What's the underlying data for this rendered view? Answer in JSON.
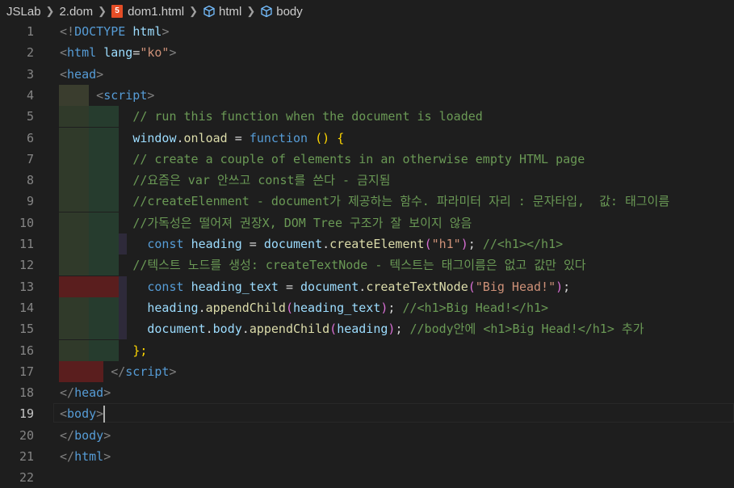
{
  "breadcrumb": {
    "items": [
      "JSLab",
      "2.dom",
      "dom1.html",
      "html",
      "body"
    ],
    "html5_badge": "5"
  },
  "editor": {
    "active_line": 19,
    "line_numbers": [
      "1",
      "2",
      "3",
      "4",
      "5",
      "6",
      "7",
      "8",
      "9",
      "10",
      "11",
      "12",
      "13",
      "14",
      "15",
      "16",
      "17",
      "18",
      "19",
      "20",
      "21",
      "22"
    ],
    "lines": [
      [
        [
          "brk",
          "<!"
        ],
        [
          "tag",
          "DOCTYPE"
        ],
        [
          "txt",
          " "
        ],
        [
          "attr",
          "html"
        ],
        [
          "brk",
          ">"
        ]
      ],
      [
        [
          "brk",
          "<"
        ],
        [
          "tag",
          "html"
        ],
        [
          "txt",
          " "
        ],
        [
          "attr",
          "lang"
        ],
        [
          "txt",
          "="
        ],
        [
          "str",
          "\"ko\""
        ],
        [
          "brk",
          ">"
        ]
      ],
      [
        [
          "brk",
          "<"
        ],
        [
          "tag",
          "head"
        ],
        [
          "brk",
          ">"
        ]
      ],
      [
        [
          "txt",
          "     "
        ],
        [
          "brk",
          "<"
        ],
        [
          "tag",
          "script"
        ],
        [
          "brk",
          ">"
        ]
      ],
      [
        [
          "txt",
          "          "
        ],
        [
          "cmt",
          "// run this function when the document is loaded"
        ]
      ],
      [
        [
          "txt",
          "          "
        ],
        [
          "var",
          "window"
        ],
        [
          "txt",
          "."
        ],
        [
          "fn",
          "onload"
        ],
        [
          "txt",
          " = "
        ],
        [
          "kw",
          "function"
        ],
        [
          "txt",
          " "
        ],
        [
          "paren2",
          "()"
        ],
        [
          "txt",
          " "
        ],
        [
          "paren2",
          "{"
        ]
      ],
      [
        [
          "txt",
          "          "
        ],
        [
          "cmt",
          "// create a couple of elements in an otherwise empty HTML page"
        ]
      ],
      [
        [
          "txt",
          "          "
        ],
        [
          "cmt",
          "//요즘은 var 안쓰고 const를 쓴다 - 금지됨"
        ]
      ],
      [
        [
          "txt",
          "          "
        ],
        [
          "cmt",
          "//createElenment - document가 제공하는 함수. 파라미터 자리 : 문자타입,  값: 태그이름"
        ]
      ],
      [
        [
          "txt",
          "          "
        ],
        [
          "cmt",
          "//가독성은 떨어져 권장X, DOM Tree 구조가 잘 보이지 않음"
        ]
      ],
      [
        [
          "txt",
          "            "
        ],
        [
          "kw",
          "const"
        ],
        [
          "txt",
          " "
        ],
        [
          "var",
          "heading"
        ],
        [
          "txt",
          " = "
        ],
        [
          "var",
          "document"
        ],
        [
          "txt",
          "."
        ],
        [
          "fn",
          "createElement"
        ],
        [
          "paren1",
          "("
        ],
        [
          "str",
          "\"h1\""
        ],
        [
          "paren1",
          ")"
        ],
        [
          "txt",
          "; "
        ],
        [
          "cmt",
          "//<h1></h1>"
        ]
      ],
      [
        [
          "txt",
          "          "
        ],
        [
          "cmt",
          "//텍스트 노드를 생성: createTextNode - 텍스트는 태그이름은 없고 값만 있다"
        ]
      ],
      [
        [
          "txt",
          "            "
        ],
        [
          "kw",
          "const"
        ],
        [
          "txt",
          " "
        ],
        [
          "var",
          "heading_text"
        ],
        [
          "txt",
          " = "
        ],
        [
          "var",
          "document"
        ],
        [
          "txt",
          "."
        ],
        [
          "fn",
          "createTextNode"
        ],
        [
          "paren1",
          "("
        ],
        [
          "str",
          "\"Big Head!\""
        ],
        [
          "paren1",
          ")"
        ],
        [
          "txt",
          ";"
        ]
      ],
      [
        [
          "txt",
          "            "
        ],
        [
          "var",
          "heading"
        ],
        [
          "txt",
          "."
        ],
        [
          "fn",
          "appendChild"
        ],
        [
          "paren1",
          "("
        ],
        [
          "var",
          "heading_text"
        ],
        [
          "paren1",
          ")"
        ],
        [
          "txt",
          "; "
        ],
        [
          "cmt",
          "//<h1>Big Head!</h1>"
        ]
      ],
      [
        [
          "txt",
          "            "
        ],
        [
          "var",
          "document"
        ],
        [
          "txt",
          "."
        ],
        [
          "var",
          "body"
        ],
        [
          "txt",
          "."
        ],
        [
          "fn",
          "appendChild"
        ],
        [
          "paren1",
          "("
        ],
        [
          "var",
          "heading"
        ],
        [
          "paren1",
          ")"
        ],
        [
          "txt",
          "; "
        ],
        [
          "cmt",
          "//body안에 <h1>Big Head!</h1> 추가"
        ]
      ],
      [
        [
          "txt",
          "          "
        ],
        [
          "paren2",
          "};"
        ]
      ],
      [
        [
          "txt",
          "       "
        ],
        [
          "brk",
          "</"
        ],
        [
          "tag",
          "script"
        ],
        [
          "brk",
          ">"
        ]
      ],
      [
        [
          "brk",
          "</"
        ],
        [
          "tag",
          "head"
        ],
        [
          "brk",
          ">"
        ]
      ],
      [
        [
          "brk",
          "<"
        ],
        [
          "tag",
          "body"
        ],
        [
          "brk",
          ">"
        ]
      ],
      [
        [
          "brk",
          "</"
        ],
        [
          "tag",
          "body"
        ],
        [
          "brk",
          ">"
        ]
      ],
      [
        [
          "brk",
          "</"
        ],
        [
          "tag",
          "html"
        ],
        [
          "brk",
          ">"
        ]
      ],
      []
    ]
  }
}
